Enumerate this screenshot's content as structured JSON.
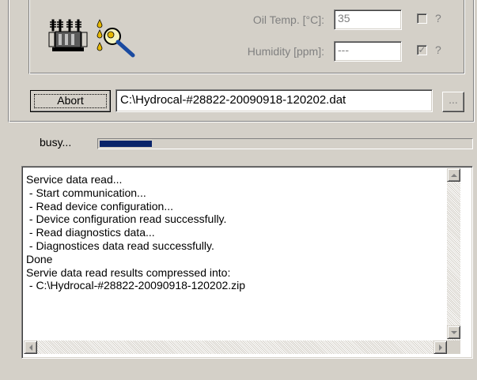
{
  "sensors": {
    "oil_temp_label": "Oil Temp. [°C]:",
    "oil_temp_value": "35",
    "oil_temp_checked": false,
    "humidity_label": "Humidity [ppm]:",
    "humidity_value": "---",
    "humidity_checked": true,
    "help_mark": "?"
  },
  "icons": {
    "transformer": "transformer-icon",
    "oil_inspection": "oil-magnifier-icon"
  },
  "actions": {
    "abort_label": "Abort",
    "file_path": "C:\\Hydrocal-#28822-20090918-120202.dat",
    "browse_label": "..."
  },
  "status": {
    "text": "busy...",
    "progress": 0.14
  },
  "log": {
    "lines": [
      "Service data read...",
      " - Start communication...",
      " - Read device configuration...",
      " - Device configuration read successfully.",
      " - Read diagnostics data...",
      " - Diagnostices data read successfully.",
      "Done",
      "Servie data read results compressed into:",
      " - C:\\Hydrocal-#28822-20090918-120202.zip"
    ]
  },
  "colors": {
    "dialog_bg": "#d4d0c8",
    "progress": "#0a246a",
    "disabled_text": "#808080"
  }
}
